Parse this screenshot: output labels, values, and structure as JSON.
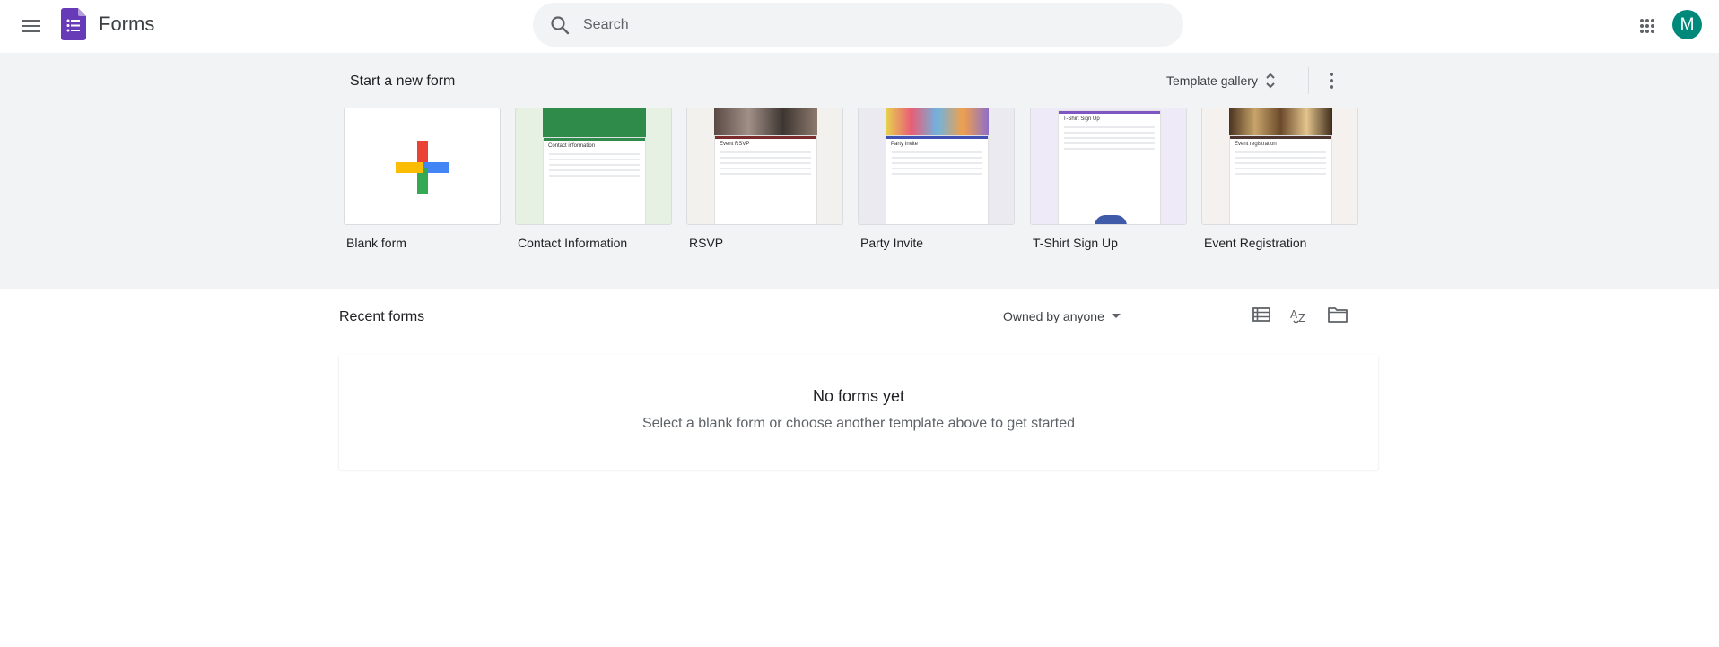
{
  "header": {
    "app_title": "Forms",
    "search_placeholder": "Search",
    "avatar_initial": "M",
    "brand_color": "#673ab7"
  },
  "templates": {
    "title": "Start a new form",
    "gallery_label": "Template gallery",
    "items": [
      {
        "label": "Blank form"
      },
      {
        "label": "Contact Information",
        "preview_title": "Contact information"
      },
      {
        "label": "RSVP",
        "preview_title": "Event RSVP"
      },
      {
        "label": "Party Invite",
        "preview_title": "Party Invite"
      },
      {
        "label": "T-Shirt Sign Up",
        "preview_title": "T-Shirt Sign Up"
      },
      {
        "label": "Event Registration",
        "preview_title": "Event registration"
      }
    ]
  },
  "recent": {
    "title": "Recent forms",
    "owner_filter": "Owned by anyone",
    "empty_title": "No forms yet",
    "empty_subtitle": "Select a blank form or choose another template above to get started"
  },
  "icons": {
    "menu": "hamburger-menu-icon",
    "search": "search-icon",
    "apps": "apps-grid-icon",
    "more": "more-vert-icon",
    "list_view": "list-view-icon",
    "sort": "sort-az-icon",
    "folder": "folder-icon"
  }
}
